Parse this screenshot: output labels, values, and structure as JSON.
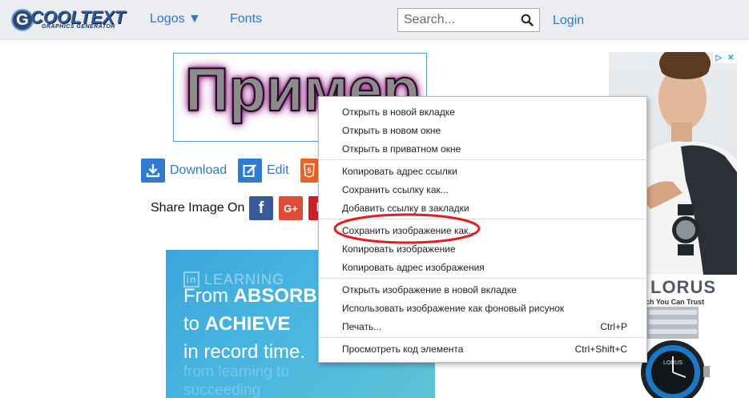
{
  "header": {
    "logo_word": "COOLTEXT",
    "logo_sub": "GRAPHICS GENERATOR",
    "nav": {
      "logos": "Logos ▼",
      "fonts": "Fonts"
    },
    "search": {
      "placeholder": "Search..."
    },
    "login": "Login"
  },
  "preview": {
    "text": "Пример"
  },
  "actions": {
    "download": "Download",
    "edit": "Edit"
  },
  "share": {
    "label": "Share Image On",
    "facebook": "f",
    "googleplus": "G+",
    "pinterest": "P"
  },
  "learning_ad": {
    "brand": "LEARNING",
    "brand_logo": "in",
    "line1_a": "From ",
    "line1_b": "ABSORB",
    "line2_a": "to ",
    "line2_b": "ACHIEVE",
    "line3": "in record time.",
    "faint1": "from learning to",
    "faint2": "succeeding"
  },
  "right_ad": {
    "brand": "LORUS",
    "tagline": "atch You Can Trust",
    "adchoice_1": "▷",
    "adchoice_2": "✕"
  },
  "context_menu": {
    "items": [
      {
        "label": "Открыть в новой вкладке",
        "shortcut": ""
      },
      {
        "label": "Открыть в новом окне",
        "shortcut": ""
      },
      {
        "label": "Открыть в приватном окне",
        "shortcut": ""
      },
      {
        "label": "Копировать адрес ссылки",
        "shortcut": ""
      },
      {
        "label": "Сохранить ссылку как...",
        "shortcut": ""
      },
      {
        "label": "Добавить ссылку в закладки",
        "shortcut": ""
      },
      {
        "label": "Сохранить изображение как...",
        "shortcut": ""
      },
      {
        "label": "Копировать изображение",
        "shortcut": ""
      },
      {
        "label": "Копировать адрес изображения",
        "shortcut": ""
      },
      {
        "label": "Открыть изображение в новой вкладке",
        "shortcut": ""
      },
      {
        "label": "Использовать изображение как фоновый рисунок",
        "shortcut": ""
      },
      {
        "label": "Печать...",
        "shortcut": "Ctrl+P"
      },
      {
        "label": "Просмотреть код элемента",
        "shortcut": "Ctrl+Shift+C"
      }
    ],
    "highlight_color": "#e02020"
  },
  "colors": {
    "link": "#2e79c7",
    "header_bg": "#ecedf0",
    "download_icon": "#2e7bd1",
    "edit_icon": "#2e7bd1",
    "html_icon": "#e8642a"
  },
  "icons": [
    "search-icon",
    "download-icon",
    "edit-icon",
    "html5-icon",
    "facebook-icon",
    "googleplus-icon",
    "pinterest-icon",
    "adchoices-icon"
  ]
}
